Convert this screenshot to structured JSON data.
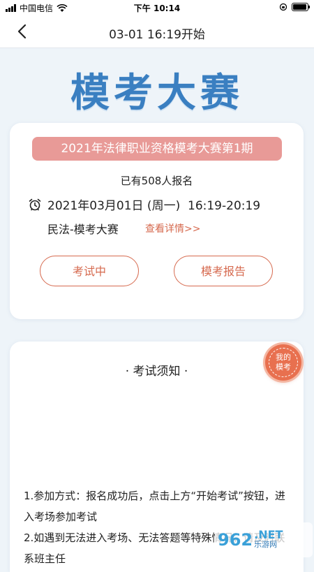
{
  "status_bar": {
    "carrier": "中国电信",
    "time": "下午 10:14",
    "icons": [
      "signal-icon",
      "wifi-icon",
      "orientation-lock-icon",
      "battery-icon"
    ]
  },
  "navbar": {
    "back_icon": "chevron-left-icon",
    "title": "03-01 16:19开始"
  },
  "hero": {
    "title": "模考大赛"
  },
  "contest_card": {
    "banner": "2021年法律职业资格模考大赛第1期",
    "enrolled": "已有508人报名",
    "clock_icon": "alarm-clock-icon",
    "datetime": "2021年03月01日 (周一)  16:19-20:19",
    "subject": "民法-模考大赛",
    "details_link": "查看详情>>",
    "buttons": {
      "exam": "考试中",
      "report": "模考报告"
    }
  },
  "notice_card": {
    "title": "· 考试须知 ·",
    "rules": [
      "1.参加方式：报名成功后，点击上方“开始考试”按钮，进入考场参加考试",
      "2.如遇到无法进入考场、无法答题等特殊情况，请及时联系班主任"
    ]
  },
  "floating_badge": {
    "line1": "我的",
    "line2": "模考"
  },
  "watermark": {
    "logo": "962",
    "net": ".NET",
    "cn": "乐游网"
  },
  "colors": {
    "hero_blue": "#3a7fc1",
    "banner_pink": "#e89a97",
    "accent_orange": "#d66a4f",
    "badge_orange": "#e8704f",
    "background": "#eef4f9"
  }
}
